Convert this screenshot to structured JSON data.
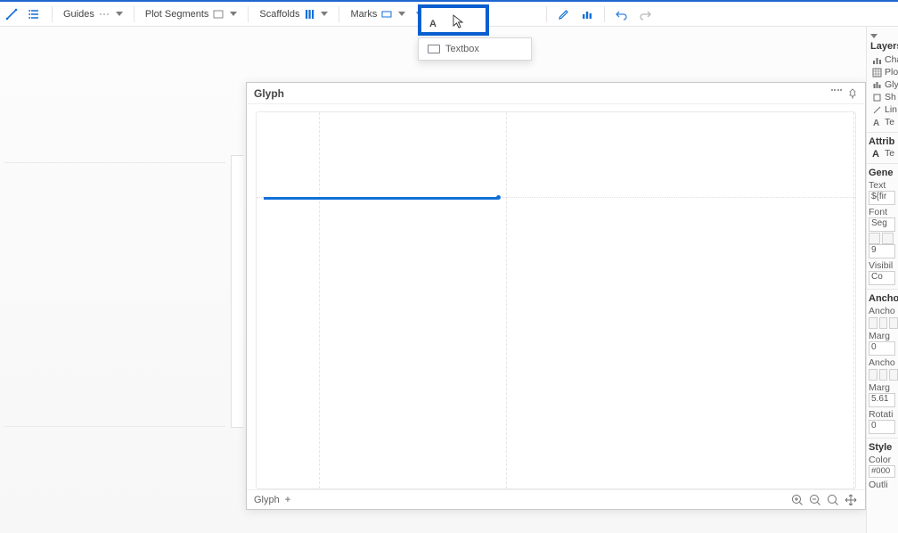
{
  "toolbar": {
    "guides_label": "Guides",
    "plot_segments_label": "Plot Segments",
    "scaffolds_label": "Scaffolds",
    "marks_label": "Marks",
    "text_flyout": {
      "letter": "A",
      "textbox_label": "Textbox"
    }
  },
  "glyph_panel": {
    "title": "Glyph",
    "footer_label": "Glyph"
  },
  "layers": {
    "title": "Layers",
    "items": [
      {
        "icon": "chart-icon",
        "label": "Chart"
      },
      {
        "icon": "plotsegment-icon",
        "label": "Plo"
      },
      {
        "icon": "glyph-icon",
        "label": "Glyph"
      },
      {
        "icon": "shape-icon",
        "label": "Sh"
      },
      {
        "icon": "link-icon",
        "label": "Lin"
      },
      {
        "icon": "text-icon",
        "label": "Te"
      }
    ]
  },
  "attributes": {
    "title": "Attrib",
    "selected": "Te",
    "general": {
      "title": "Gene",
      "text_label": "Text",
      "text_value": "${fir",
      "font_label": "Font",
      "font_value": "Seg",
      "size_value": "9",
      "visibility_label": "Visibil",
      "visibility_value": "Co"
    },
    "anchor": {
      "title": "Ancho",
      "anchor_label": "Ancho",
      "margin_label": "Marg",
      "margin_value": "0",
      "anchor_label2": "Ancho",
      "margin_label2": "Marg",
      "margin_value2": "5.61",
      "rotation_label": "Rotati",
      "rotation_value": "0"
    },
    "style": {
      "title": "Style",
      "color_label": "Color",
      "color_value": "#000",
      "outline_label": "Outli"
    }
  }
}
